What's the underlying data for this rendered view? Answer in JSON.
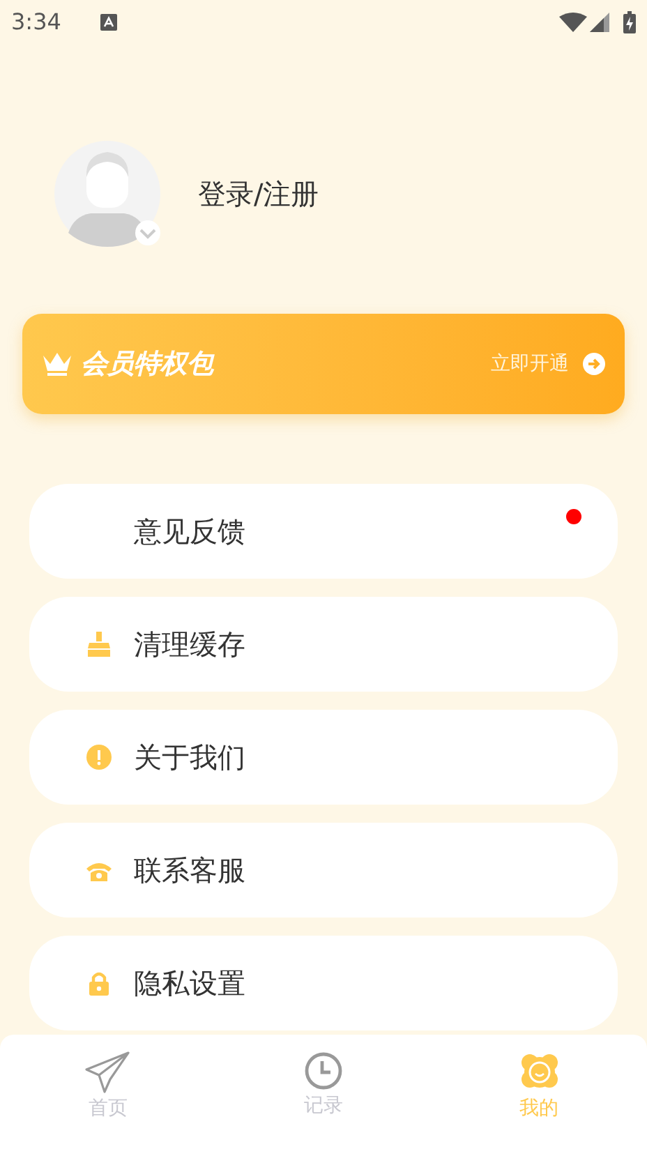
{
  "status_bar": {
    "time": "3:34"
  },
  "profile": {
    "login_label": "登录/注册"
  },
  "vip_banner": {
    "title": "会员特权包",
    "action": "立即开通"
  },
  "menu": [
    {
      "label": "意见反馈",
      "unread": true
    },
    {
      "label": "清理缓存",
      "unread": false
    },
    {
      "label": "关于我们",
      "unread": false
    },
    {
      "label": "联系客服",
      "unread": false
    },
    {
      "label": "隐私设置",
      "unread": false
    }
  ],
  "tab_bar": [
    {
      "label": "首页",
      "selected": false
    },
    {
      "label": "记录",
      "selected": false
    },
    {
      "label": "我的",
      "selected": true
    }
  ]
}
